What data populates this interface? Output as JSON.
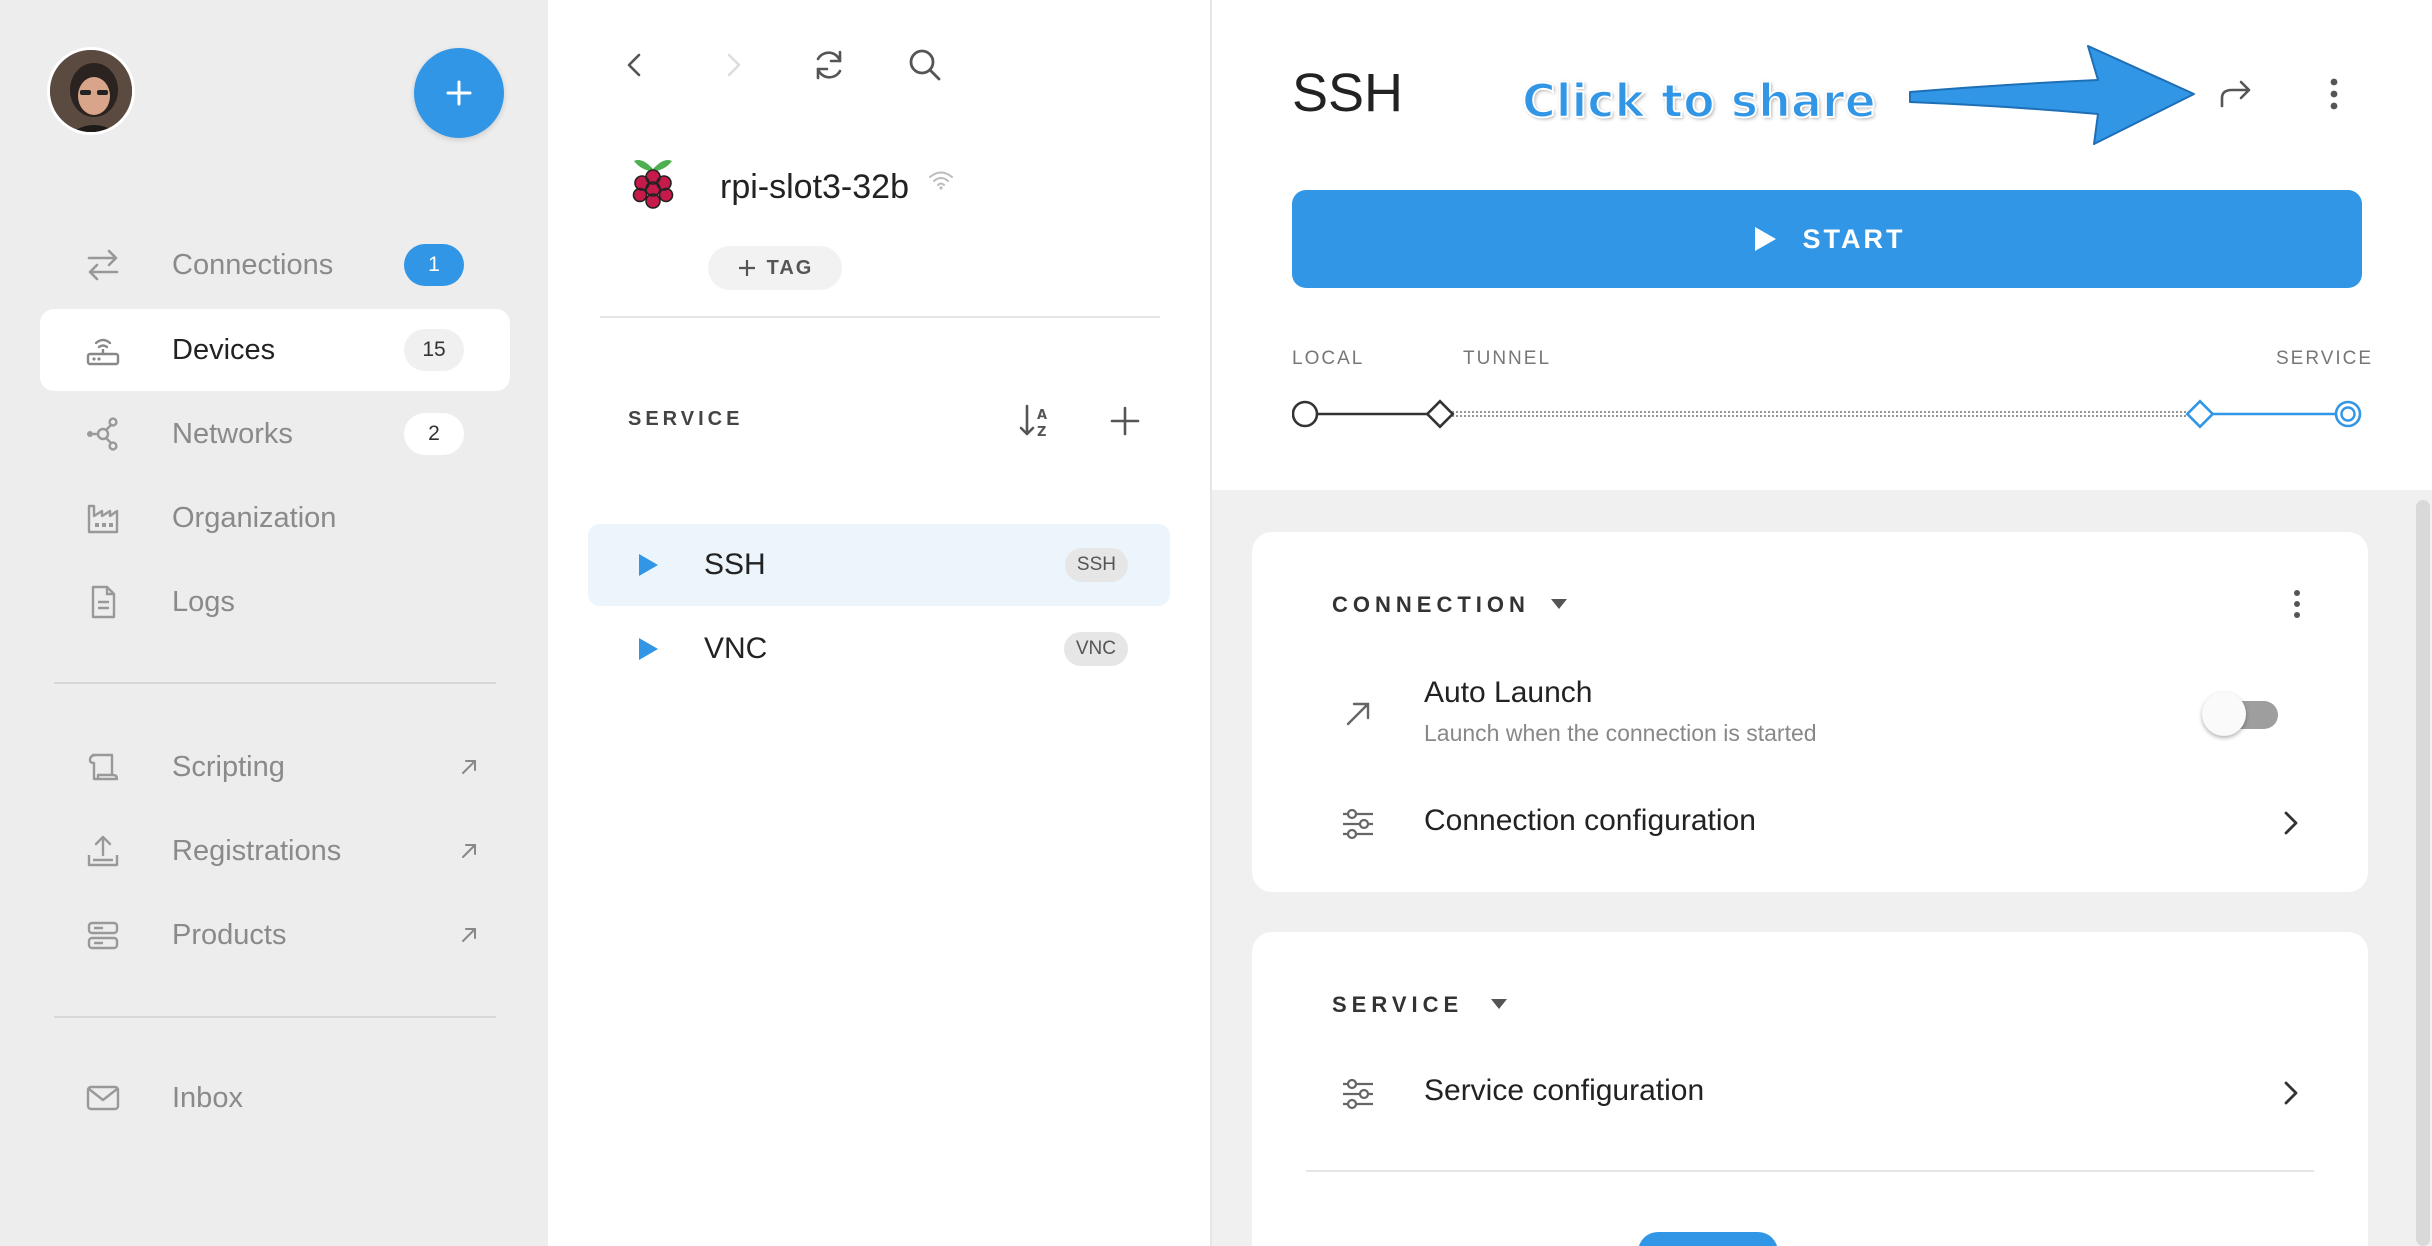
{
  "sidebar": {
    "nav": [
      {
        "label": "Connections",
        "badge": "1",
        "icon": "swap-arrows-icon"
      },
      {
        "label": "Devices",
        "badge": "15",
        "icon": "router-icon"
      },
      {
        "label": "Networks",
        "badge": "2",
        "icon": "network-hub-icon"
      },
      {
        "label": "Organization",
        "icon": "factory-icon"
      },
      {
        "label": "Logs",
        "icon": "document-icon"
      }
    ],
    "external": [
      {
        "label": "Scripting",
        "icon": "script-scroll-icon"
      },
      {
        "label": "Registrations",
        "icon": "upload-tray-icon"
      },
      {
        "label": "Products",
        "icon": "server-stack-icon"
      }
    ],
    "inbox": {
      "label": "Inbox",
      "icon": "mail-icon"
    }
  },
  "middle": {
    "device_name": "rpi-slot3-32b",
    "tag_label": "TAG",
    "section_label": "SERVICE",
    "services": [
      {
        "label": "SSH",
        "chip": "SSH"
      },
      {
        "label": "VNC",
        "chip": "VNC"
      }
    ]
  },
  "right": {
    "title": "SSH",
    "annotation": "Click to share",
    "start_label": "START",
    "route": {
      "local": "LOCAL",
      "tunnel": "TUNNEL",
      "service": "SERVICE"
    },
    "connection_card": {
      "heading": "CONNECTION",
      "auto_launch_title": "Auto Launch",
      "auto_launch_sub": "Launch when the connection is started",
      "auto_launch_on": false,
      "config_label": "Connection configuration"
    },
    "service_card": {
      "heading": "SERVICE",
      "config_label": "Service configuration"
    }
  },
  "colors": {
    "accent": "#3196e6",
    "sidebar_bg": "#ededed",
    "selected_bg": "#ecf5fc"
  }
}
